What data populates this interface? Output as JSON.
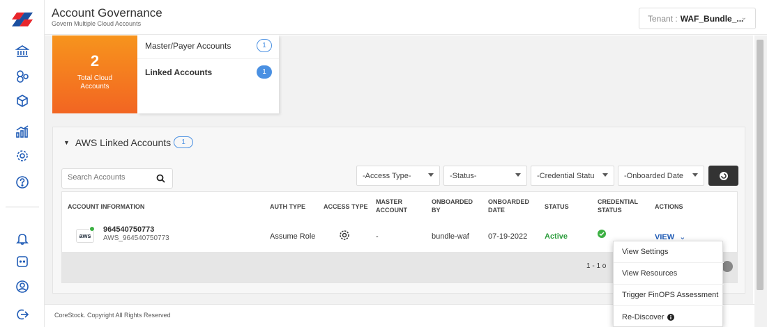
{
  "header": {
    "title": "Account Governance",
    "subtitle": "Govern Multiple Cloud Accounts",
    "tenant_label": "Tenant :",
    "tenant_value": "WAF_Bundle_..."
  },
  "summary": {
    "total_count": "2",
    "total_label": "Total Cloud Accounts",
    "account_types": [
      {
        "label": "Master/Payer Accounts",
        "count": "1"
      },
      {
        "label": "Linked Accounts",
        "count": "1"
      }
    ]
  },
  "linked": {
    "title": "AWS Linked Accounts",
    "count": "1",
    "search_placeholder": "Search Accounts",
    "filters": [
      "-Access Type-",
      "-Status-",
      "-Credential Statu",
      "-Onboarded Date"
    ],
    "columns": {
      "account_info": "ACCOUNT INFORMATION",
      "auth_type": "AUTH TYPE",
      "access_type": "ACCESS TYPE",
      "master_1": "MASTER",
      "master_2": "ACCOUNT",
      "onb_by_1": "ONBOARDED",
      "onb_by_2": "BY",
      "onb_date_1": "ONBOARDED",
      "onb_date_2": "DATE",
      "status": "STATUS",
      "cred_1": "CREDENTIAL",
      "cred_2": "STATUS",
      "actions": "ACTIONS"
    },
    "row": {
      "provider": "aws",
      "account_id": "964540750773",
      "account_name": "AWS_964540750773",
      "auth_type": "Assume Role",
      "master_account": "-",
      "onboarded_by": "bundle-waf",
      "onboarded_date": "07-19-2022",
      "status": "Active",
      "action_label": "VIEW"
    },
    "pagination": "1 - 1 o"
  },
  "action_menu": [
    "View Settings",
    "View Resources",
    "Trigger FinOPS Assessment",
    "Re-Discover"
  ],
  "footer": "CoreStock. Copyright All Rights Reserved",
  "colors": {
    "accent": "#4a90e2",
    "orange": "#f26522",
    "active_green": "#2e9e3e"
  }
}
